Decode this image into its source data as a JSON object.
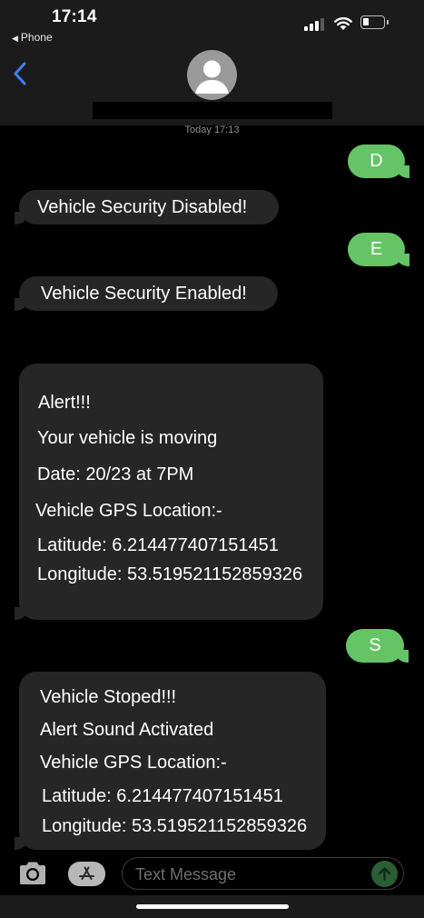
{
  "status_bar": {
    "time": "17:14",
    "back_app_label": "Phone"
  },
  "header": {
    "back_label": "Back",
    "contact_name": ""
  },
  "conversation": {
    "timestamp": "Today 17:13",
    "messages": [
      {
        "direction": "sent",
        "lines": [
          "D"
        ]
      },
      {
        "direction": "received",
        "lines": [
          "Vehicle Security Disabled!"
        ]
      },
      {
        "direction": "sent",
        "lines": [
          "E"
        ]
      },
      {
        "direction": "received",
        "lines": [
          "Vehicle Security Enabled!"
        ]
      },
      {
        "direction": "received",
        "lines": [
          "Alert!!!",
          "Your vehicle is moving",
          "Date: 20/23 at 7PM",
          "Vehicle GPS Location:-",
          "Latitude: 6.214477407151451",
          "Longitude: 53.519521152859326"
        ]
      },
      {
        "direction": "sent",
        "lines": [
          "S"
        ]
      },
      {
        "direction": "received",
        "lines": [
          "Vehicle Stoped!!!",
          "Alert Sound Activated",
          "Vehicle GPS Location:-",
          "Latitude: 6.214477407151451",
          "Longitude: 53.519521152859326"
        ]
      }
    ]
  },
  "input_bar": {
    "placeholder": "Text Message",
    "camera_icon": "camera-icon",
    "apps_icon": "app-store-icon",
    "send_icon": "arrow-up-icon"
  },
  "colors": {
    "sent_bubble": "#65c466",
    "received_bubble": "#262626",
    "accent_blue": "#3b82f6",
    "header_bg": "#1b1b1b"
  }
}
